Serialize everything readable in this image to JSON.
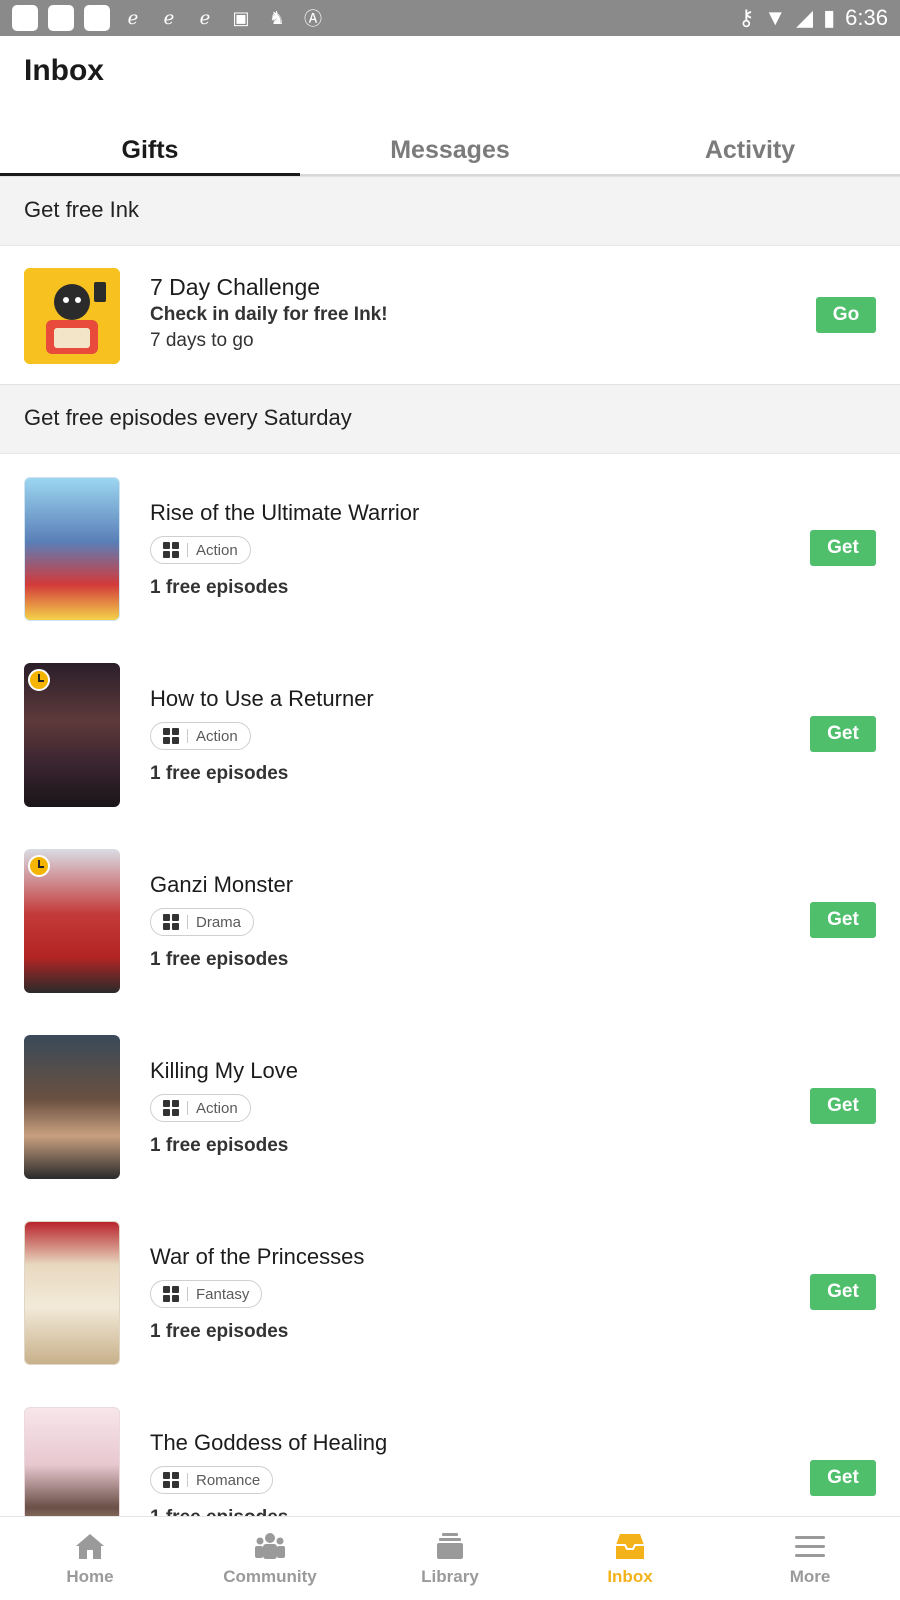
{
  "status_bar": {
    "time": "6:36"
  },
  "header": {
    "title": "Inbox"
  },
  "tabs": [
    {
      "label": "Gifts",
      "active": true
    },
    {
      "label": "Messages",
      "active": false
    },
    {
      "label": "Activity",
      "active": false
    }
  ],
  "sections": {
    "ink": {
      "heading": "Get free Ink",
      "item": {
        "title": "7 Day Challenge",
        "subtitle": "Check in daily for free Ink!",
        "note": "7 days to go",
        "button": "Go"
      }
    },
    "episodes": {
      "heading": "Get free episodes every Saturday",
      "items": [
        {
          "title": "Rise of the Ultimate Warrior",
          "genre": "Action",
          "free": "1 free episodes",
          "button": "Get"
        },
        {
          "title": "How to Use a Returner",
          "genre": "Action",
          "free": "1 free episodes",
          "button": "Get"
        },
        {
          "title": "Ganzi Monster",
          "genre": "Drama",
          "free": "1 free episodes",
          "button": "Get"
        },
        {
          "title": "Killing My Love",
          "genre": "Action",
          "free": "1 free episodes",
          "button": "Get"
        },
        {
          "title": "War of the Princesses",
          "genre": "Fantasy",
          "free": "1 free episodes",
          "button": "Get"
        },
        {
          "title": "The Goddess of Healing",
          "genre": "Romance",
          "free": "1 free episodes",
          "button": "Get"
        }
      ]
    }
  },
  "bottom_nav": [
    {
      "label": "Home",
      "icon": "home-icon",
      "active": false
    },
    {
      "label": "Community",
      "icon": "community-icon",
      "active": false
    },
    {
      "label": "Library",
      "icon": "library-icon",
      "active": false
    },
    {
      "label": "Inbox",
      "icon": "inbox-icon",
      "active": true
    },
    {
      "label": "More",
      "icon": "menu-icon",
      "active": false
    }
  ],
  "colors": {
    "accent": "#f3b21a",
    "button_green": "#4fbf6c",
    "section_bg": "#f3f3f3"
  }
}
